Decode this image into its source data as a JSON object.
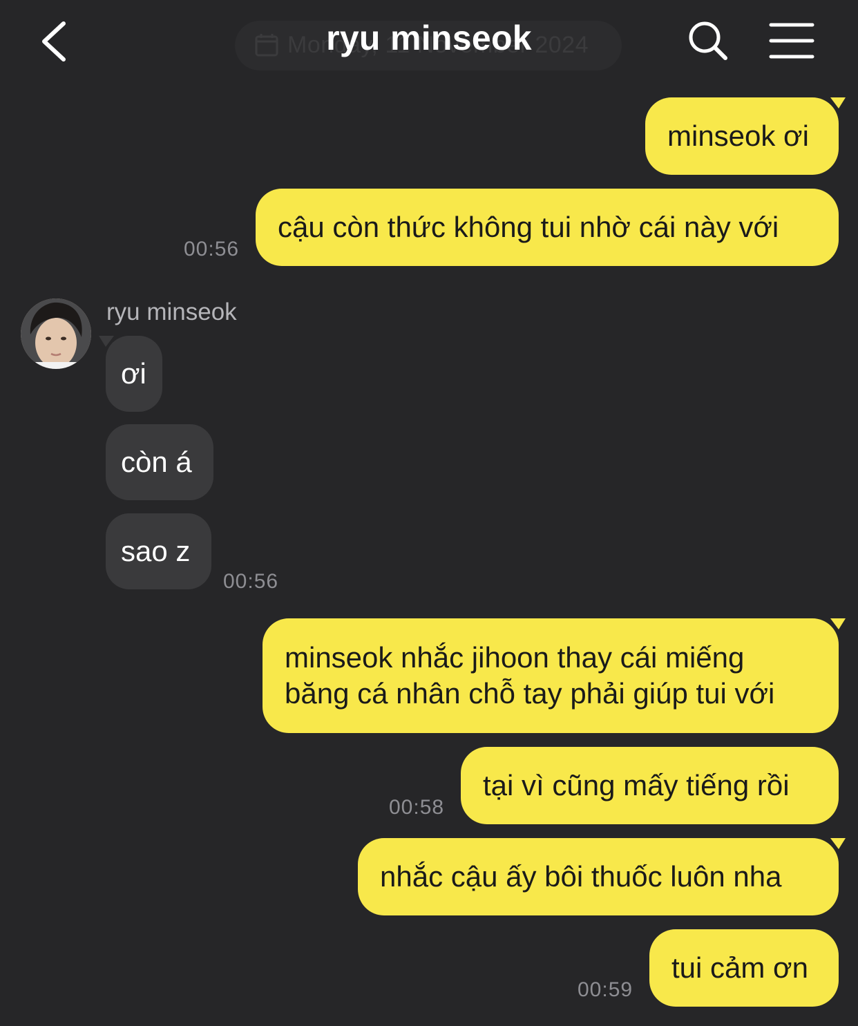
{
  "header": {
    "title": "ryu minseok",
    "date_label": "Monday, 11 November 2024"
  },
  "contact": {
    "name": "ryu minseok",
    "avatar_icon": "profile-photo"
  },
  "colors": {
    "background": "#262628",
    "outgoing_bubble": "#f8e84b",
    "incoming_bubble": "#3a3a3c",
    "timestamp": "#8e8e93"
  },
  "messages": [
    {
      "direction": "out",
      "text": "minseok ơi"
    },
    {
      "direction": "out",
      "text": "cậu còn thức không tui nhờ cái này với",
      "time": "00:56"
    },
    {
      "direction": "in",
      "text": "ơi"
    },
    {
      "direction": "in",
      "text": "còn á"
    },
    {
      "direction": "in",
      "text": "sao z",
      "time": "00:56"
    },
    {
      "direction": "out",
      "text": "minseok nhắc jihoon thay cái miếng băng cá nhân chỗ tay phải giúp tui với"
    },
    {
      "direction": "out",
      "text": "tại vì cũng mấy tiếng rồi",
      "time": "00:58"
    },
    {
      "direction": "out",
      "text": "nhắc cậu ấy bôi thuốc luôn nha"
    },
    {
      "direction": "out",
      "text": "tui cảm ơn",
      "time": "00:59"
    }
  ]
}
